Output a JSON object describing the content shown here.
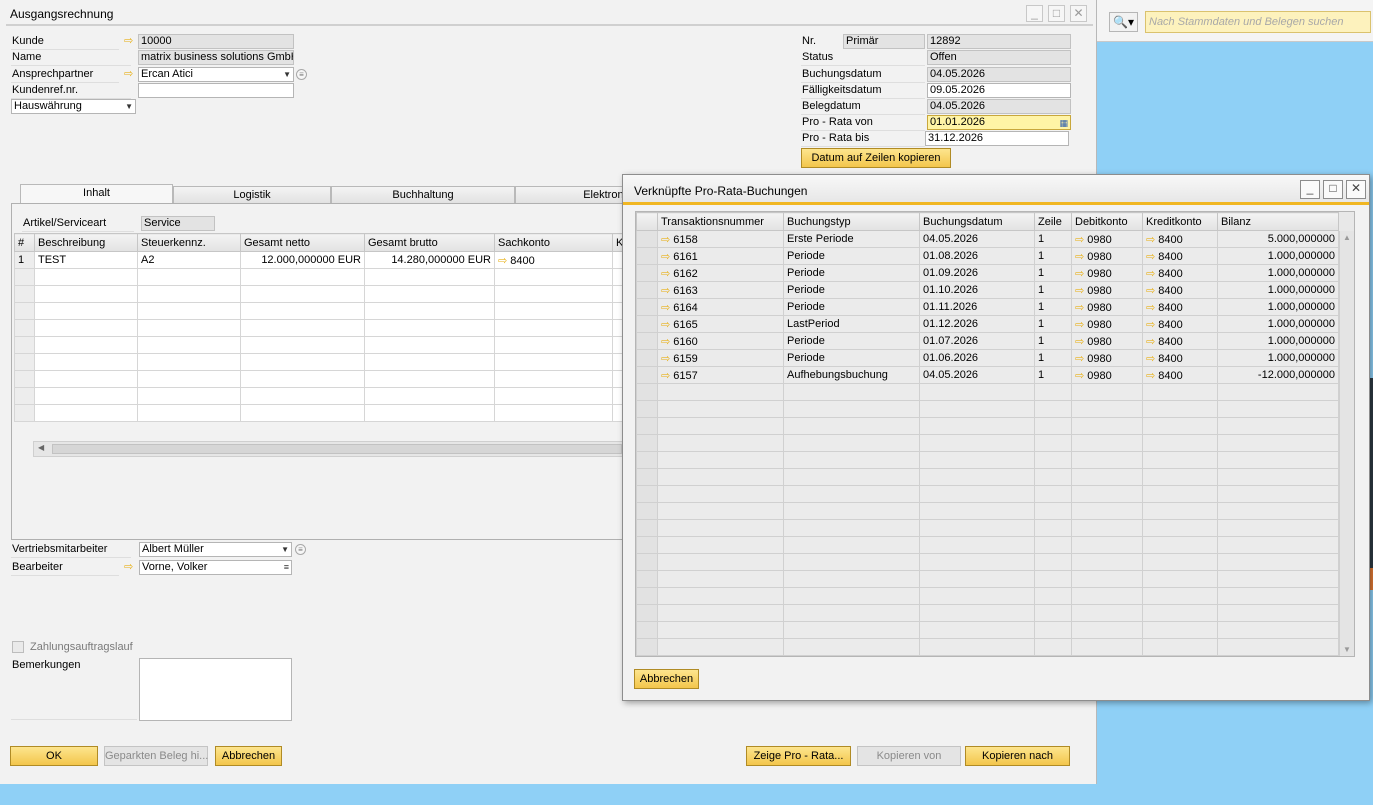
{
  "main": {
    "title": "Ausgangsrechnung",
    "header_left": {
      "kunde_label": "Kunde",
      "kunde_value": "10000",
      "name_label": "Name",
      "name_value": "matrix business solutions GmbH",
      "ansprech_label": "Ansprechpartner",
      "ansprech_value": "Ercan Atici",
      "kundenref_label": "Kundenref.nr.",
      "kundenref_value": "",
      "waehrung_value": "Hauswährung"
    },
    "header_right": {
      "nr_label": "Nr.",
      "nr_series": "Primär",
      "nr_value": "12892",
      "status_label": "Status",
      "status_value": "Offen",
      "buchungsdatum_label": "Buchungsdatum",
      "buchungsdatum_value": "04.05.2026",
      "faelligkeit_label": "Fälligkeitsdatum",
      "faelligkeit_value": "09.05.2026",
      "belegdatum_label": "Belegdatum",
      "belegdatum_value": "04.05.2026",
      "prorata_von_label": "Pro - Rata von",
      "prorata_von_value": "01.01.2026",
      "prorata_bis_label": "Pro - Rata bis",
      "prorata_bis_value": "31.12.2026",
      "copy_button": "Datum auf Zeilen kopieren"
    },
    "tabs": [
      {
        "label": "Inhalt"
      },
      {
        "label": "Logistik"
      },
      {
        "label": "Buchhaltung"
      },
      {
        "label": "Elektroni"
      }
    ],
    "artikel_label": "Artikel/Serviceart",
    "artikel_value": "Service",
    "lines_columns": [
      "#",
      "Beschreibung",
      "Steuerkennz.",
      "Gesamt netto",
      "Gesamt brutto",
      "Sachkonto",
      "K"
    ],
    "lines": [
      {
        "nr": "1",
        "beschreibung": "TEST",
        "steuer": "A2",
        "netto": "12.000,000000 EUR",
        "brutto": "14.280,000000 EUR",
        "sachkonto": "8400"
      }
    ],
    "footer": {
      "vertrieb_label": "Vertriebsmitarbeiter",
      "vertrieb_value": "Albert Müller",
      "bearbeiter_label": "Bearbeiter",
      "bearbeiter_value": "Vorne, Volker",
      "zahlungslauf_label": "Zahlungsauftragslauf",
      "bemerkungen_label": "Bemerkungen"
    },
    "buttons": {
      "ok": "OK",
      "geparkt": "Geparkten Beleg hi...",
      "abbrechen": "Abbrechen",
      "zeige": "Zeige Pro - Rata...",
      "kopieren_von": "Kopieren von",
      "kopieren_nach": "Kopieren nach"
    }
  },
  "popup": {
    "title": "Verknüpfte Pro-Rata-Buchungen",
    "columns": [
      "Transaktionsnummer",
      "Buchungstyp",
      "Buchungsdatum",
      "Zeile",
      "Debitkonto",
      "Kreditkonto",
      "Bilanz"
    ],
    "rows": [
      {
        "tx": "6158",
        "typ": "Erste Periode",
        "datum": "04.05.2026",
        "zeile": "1",
        "debit": "0980",
        "kredit": "8400",
        "bilanz": "5.000,000000"
      },
      {
        "tx": "6161",
        "typ": "Periode",
        "datum": "01.08.2026",
        "zeile": "1",
        "debit": "0980",
        "kredit": "8400",
        "bilanz": "1.000,000000"
      },
      {
        "tx": "6162",
        "typ": "Periode",
        "datum": "01.09.2026",
        "zeile": "1",
        "debit": "0980",
        "kredit": "8400",
        "bilanz": "1.000,000000"
      },
      {
        "tx": "6163",
        "typ": "Periode",
        "datum": "01.10.2026",
        "zeile": "1",
        "debit": "0980",
        "kredit": "8400",
        "bilanz": "1.000,000000"
      },
      {
        "tx": "6164",
        "typ": "Periode",
        "datum": "01.11.2026",
        "zeile": "1",
        "debit": "0980",
        "kredit": "8400",
        "bilanz": "1.000,000000"
      },
      {
        "tx": "6165",
        "typ": "LastPeriod",
        "datum": "01.12.2026",
        "zeile": "1",
        "debit": "0980",
        "kredit": "8400",
        "bilanz": "1.000,000000"
      },
      {
        "tx": "6160",
        "typ": "Periode",
        "datum": "01.07.2026",
        "zeile": "1",
        "debit": "0980",
        "kredit": "8400",
        "bilanz": "1.000,000000"
      },
      {
        "tx": "6159",
        "typ": "Periode",
        "datum": "01.06.2026",
        "zeile": "1",
        "debit": "0980",
        "kredit": "8400",
        "bilanz": "1.000,000000"
      },
      {
        "tx": "6157",
        "typ": "Aufhebungsbuchung",
        "datum": "04.05.2026",
        "zeile": "1",
        "debit": "0980",
        "kredit": "8400",
        "bilanz": "-12.000,000000"
      }
    ],
    "cancel_button": "Abbrechen"
  },
  "search": {
    "placeholder": "Nach Stammdaten und Belegen suchen"
  },
  "colors": {
    "accent": "#f0b622",
    "desktop": "#8fd0f6",
    "link_arrow": "#e8b11a"
  }
}
